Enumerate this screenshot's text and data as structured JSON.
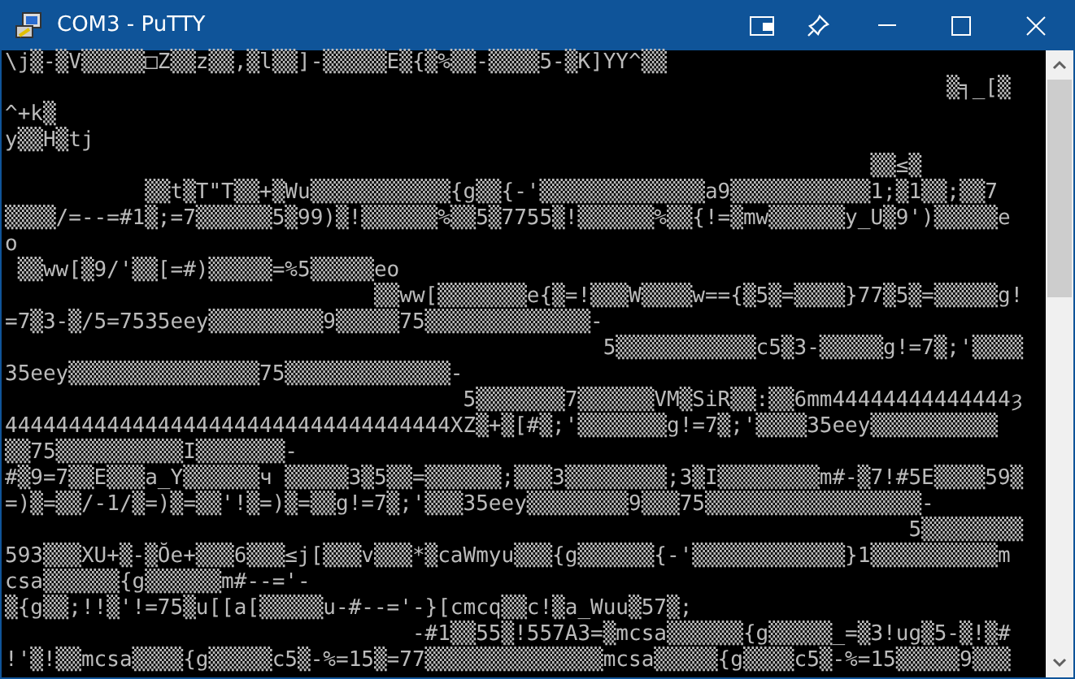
{
  "window": {
    "title": "COM3 - PuTTY"
  },
  "terminal": {
    "lines": [
      "\\j▒-▒V▒▒▒▒▒□Z▒▒z▒▒,▒l▒▒]-▒▒▒▒▒E▒{▒%▒▒-▒▒▒▒5-▒K]YY^▒▒",
      "                                                                          ▒╕_[▒",
      "^+k▒",
      "y▒▒H▒tj",
      "                                                                    ▒▒≤▒",
      "           ▒▒t▒T\"T▒▒+▒Wu▒▒▒▒▒▒▒▒▒▒▒{g▒▒{-'▒▒▒▒▒▒▒▒▒▒▒▒▒a9▒▒▒▒▒▒▒▒▒▒▒1;▒1▒▒;▒▒7",
      "▒▒▒▒/=--=#1▒;=7▒▒▒▒▒▒5▒99)▒!▒▒▒▒▒▒%▒▒5▒7755▒!▒▒▒▒▒▒%▒▒{!=▒mw▒▒▒▒▒▒y_U▒9')▒▒▒▒▒e",
      "o",
      " ▒▒ww[▒9/'▒▒[=#)▒▒▒▒▒=%5▒▒▒▒▒eo",
      "                             ▒▒ww[▒▒▒▒▒▒▒e{▒=!▒▒▒W▒▒▒▒w=={▒5▒=▒▒▒▒}77▒5▒=▒▒▒▒▒g!",
      "=7▒3-▒/5=7535eey▒▒▒▒▒▒▒▒▒9▒▒▒▒▒75▒▒▒▒▒▒▒▒▒▒▒▒▒-",
      "                                               5▒▒▒▒▒▒▒▒▒▒▒c5▒3-▒▒▒▒▒g!=7▒;'▒▒▒▒",
      "35eey▒▒▒▒▒▒▒▒▒▒▒▒▒▒▒75▒▒▒▒▒▒▒▒▒▒▒▒▒-",
      "                                    5▒▒▒▒▒▒▒7▒▒▒▒▒▒VM▒SiR▒▒:▒▒6mm44444444444444ȝ",
      "44444444444444444444444444444444444XZ▒+▒[#▒;'▒▒▒▒▒▒▒g!=7▒;'▒▒▒▒35eey▒▒▒▒▒▒▒▒▒▒",
      "▒▒75▒▒▒▒▒▒▒▒▒▒I▒▒▒▒▒▒▒-",
      "#▒9=7▒▒E▒▒▒a_Y▒▒▒▒▒▒ч ▒▒▒▒▒3▒5▒▒=▒▒▒▒▒▒;▒▒▒3▒▒▒▒▒▒▒▒;3▒I▒▒▒▒▒▒▒▒m#-▒7!#5E▒▒▒▒59▒",
      "=)▒=▒▒/-1/▒=)▒=▒▒'!▒=)▒=▒▒g!=7▒;'▒▒▒35eey▒▒▒▒▒▒▒▒9▒▒▒75▒▒▒▒▒▒▒▒▒▒▒▒▒▒▒▒▒-",
      "                                                                       5▒▒▒▒▒▒▒▒",
      "593▒▒▒XU+▒-▒Ŏe+▒▒▒6▒▒▒≤j[▒▒▒v▒▒▒*▒caWmyu▒▒▒{g▒▒▒▒▒▒{-'▒▒▒▒▒▒▒▒▒▒▒▒}1▒▒▒▒▒▒▒▒▒▒m",
      "csa▒▒▒▒▒▒{g▒▒▒▒▒▒m#--='-",
      "▒{g▒▒;!!▒'!=75▒u[[a[▒▒▒▒▒u-#--='-}[cmcq▒▒c!▒a_Wuu▒57▒;",
      "                                -#1▒▒55▒!557A3=▒mcsa▒▒▒▒▒▒{g▒▒▒▒▒_=▒3!ug▒5-▒!▒#",
      "!'▒!▒▒mcsa▒▒▒▒{g▒▒▒▒▒c5▒-%=15▒=77▒▒▒▒▒▒▒▒▒▒▒▒▒▒mcsa▒▒▒▒▒{g▒▒▒▒c5▒-%=15▒▒▒▒▒9▒▒▒"
    ]
  }
}
